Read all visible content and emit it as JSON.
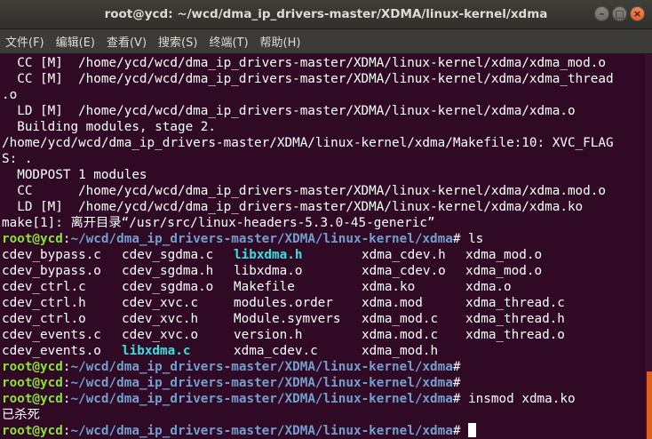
{
  "window": {
    "title": "root@ycd: ~/wcd/dma_ip_drivers-master/XDMA/linux-kernel/xdma",
    "buttons": {
      "minimize": "–",
      "maximize": "□",
      "close": "×"
    }
  },
  "menu": {
    "items": [
      "文件(F)",
      "编辑(E)",
      "查看(V)",
      "搜索(S)",
      "终端(T)",
      "帮助(H)"
    ]
  },
  "output_top": [
    "  CC [M]  /home/ycd/wcd/dma_ip_drivers-master/XDMA/linux-kernel/xdma/xdma_mod.o",
    "  CC [M]  /home/ycd/wcd/dma_ip_drivers-master/XDMA/linux-kernel/xdma/xdma_thread",
    ".o",
    "  LD [M]  /home/ycd/wcd/dma_ip_drivers-master/XDMA/linux-kernel/xdma/xdma.o",
    "  Building modules, stage 2.",
    "/home/ycd/wcd/dma_ip_drivers-master/XDMA/linux-kernel/xdma/Makefile:10: XVC_FLAG",
    "S: .",
    "  MODPOST 1 modules",
    "  CC      /home/ycd/wcd/dma_ip_drivers-master/XDMA/linux-kernel/xdma/xdma.mod.o",
    "  LD [M]  /home/ycd/wcd/dma_ip_drivers-master/XDMA/linux-kernel/xdma/xdma.ko",
    "make[1]: 离开目录“/usr/src/linux-headers-5.3.0-45-generic”"
  ],
  "prompt": {
    "user": "root@ycd",
    "sep": ":",
    "path": "~/wcd/dma_ip_drivers-master/XDMA/linux-kernel/xdma",
    "symbol": "# "
  },
  "commands": {
    "ls": "ls",
    "insmod": "insmod xdma.ko"
  },
  "ls_rows": [
    [
      "cdev_bypass.c",
      "cdev_sgdma.c",
      "libxdma.h",
      "xdma_cdev.h",
      "xdma_mod.o"
    ],
    [
      "cdev_bypass.o",
      "cdev_sgdma.h",
      "libxdma.o",
      "xdma_cdev.o",
      "xdma_mod.o"
    ],
    [
      "cdev_ctrl.c",
      "cdev_sgdma.o",
      "Makefile",
      "xdma.ko",
      "xdma.o"
    ],
    [
      "cdev_ctrl.h",
      "cdev_xvc.c",
      "modules.order",
      "xdma.mod",
      "xdma_thread.c"
    ],
    [
      "cdev_ctrl.o",
      "cdev_xvc.h",
      "Module.symvers",
      "xdma_mod.c",
      "xdma_thread.h"
    ],
    [
      "cdev_events.c",
      "cdev_xvc.o",
      "version.h",
      "xdma.mod.c",
      "xdma_thread.o"
    ],
    [
      "cdev_events.o",
      "libxdma.c",
      "xdma_cdev.c",
      "xdma_mod.h",
      ""
    ]
  ],
  "killed_msg": "已杀死",
  "colors": {
    "background": "#300a24",
    "prompt_user": "#8ae234",
    "prompt_path": "#729fcf",
    "source_file": "#34e2e2",
    "scroll_thumb": "#e0601c"
  }
}
